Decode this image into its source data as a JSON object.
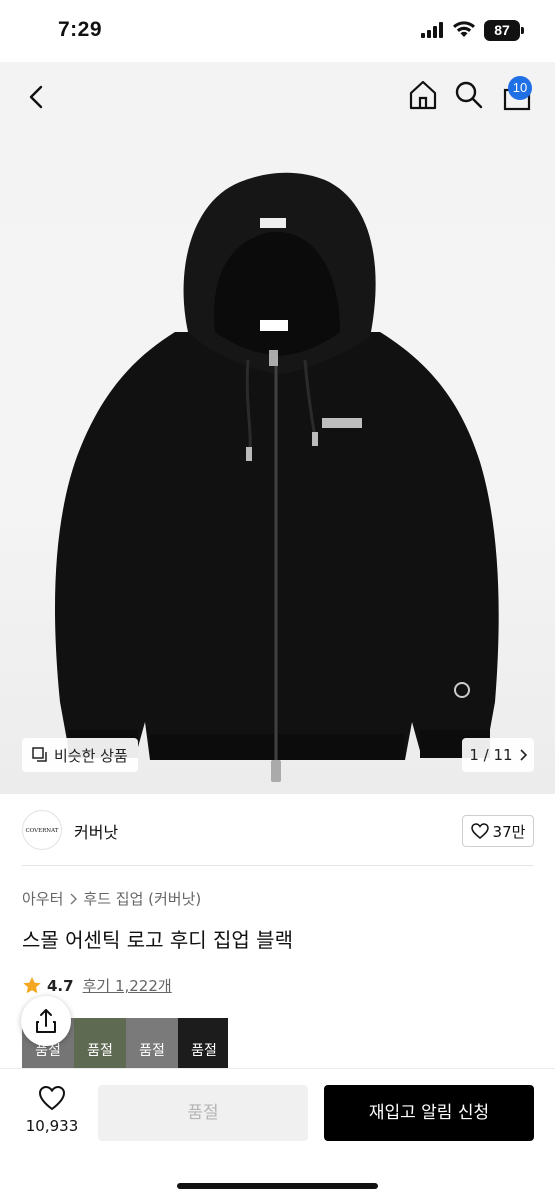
{
  "status_bar": {
    "time": "7:29",
    "battery": "87"
  },
  "nav": {
    "cart_count": "10"
  },
  "hero": {
    "similar_label": "비슷한 상품",
    "page_counter": "1 / 11"
  },
  "brand": {
    "logo_text": "COVERNAT",
    "name": "커버낫",
    "likes": "37만"
  },
  "breadcrumb": {
    "level1": "아우터",
    "level2": "후드 집업 (커버낫)"
  },
  "product": {
    "title": "스몰 어센틱 로고 후디 집업 블랙"
  },
  "rating": {
    "score": "4.7",
    "reviews": "후기 1,222개"
  },
  "swatches": [
    {
      "label": "품절",
      "color": "#9c9c9c"
    },
    {
      "label": "품절",
      "color": "#7e8f6e"
    },
    {
      "label": "품절",
      "color": "#a3a3a3"
    },
    {
      "label": "품절",
      "color": "#1c1c1c"
    }
  ],
  "bottom": {
    "wish_count": "10,933",
    "soldout_label": "품절",
    "restock_label": "재입고 알림 신청"
  },
  "colors": {
    "badge": "#1f6fe5",
    "primary_button": "#000000"
  }
}
